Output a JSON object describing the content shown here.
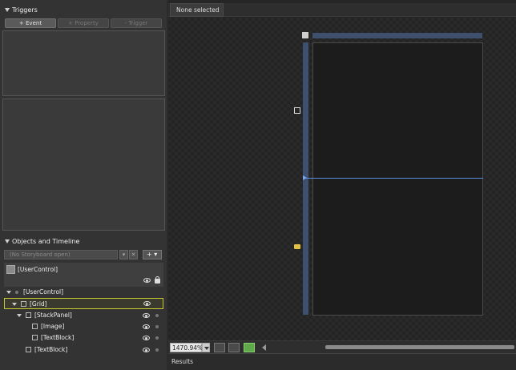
{
  "triggers": {
    "title": "Triggers",
    "buttons": [
      {
        "label": "+ Event",
        "enabled": true
      },
      {
        "label": "+ Property",
        "enabled": false
      },
      {
        "label": "- Trigger",
        "enabled": false
      }
    ]
  },
  "objects": {
    "title": "Objects and Timeline",
    "storyboard_placeholder": "(No Storyboard open)",
    "add_label": "+ ▾",
    "root": "[UserControl]",
    "tree": [
      {
        "label": "[UserControl]"
      },
      {
        "label": "[Grid]"
      },
      {
        "label": "[StackPanel]"
      },
      {
        "label": "[Image]"
      },
      {
        "label": "[TextBlock]"
      },
      {
        "label": "[TextBlock]"
      }
    ]
  },
  "main": {
    "tab_label": "None selected",
    "zoom": "1470.94%",
    "results_label": "Results"
  },
  "colors": {
    "selection_border": "#c8c830",
    "grid_split_line": "#5b8ee0",
    "ruler": "#3f4f6e"
  }
}
